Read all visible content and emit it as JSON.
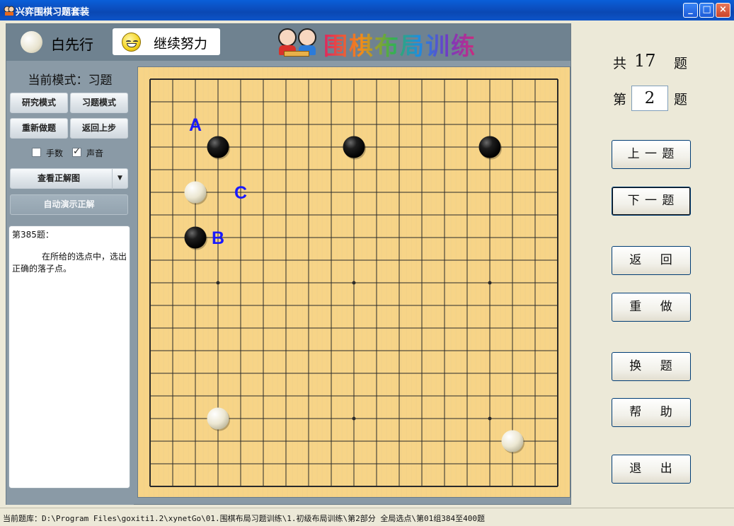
{
  "window": {
    "title": "兴弈围棋习题套装",
    "min": "_",
    "max": "□",
    "close": "×"
  },
  "header": {
    "turn_text": "白先行",
    "status_text": "继续努力",
    "banner_text": "围棋布局训练"
  },
  "sidebar": {
    "mode_title": "当前模式：习题",
    "buttons": {
      "research": "研究模式",
      "exercise": "习题模式",
      "redo": "重新做题",
      "back_step": "返回上步",
      "view_answer": "查看正解图",
      "auto_demo": "自动演示正解"
    },
    "checkboxes": {
      "move_numbers": {
        "label": "手数",
        "checked": false
      },
      "sound": {
        "label": "声音",
        "checked": true
      }
    },
    "problem": {
      "title": "第385题：",
      "description": "在所给的选点中，选出正确的落子点。"
    }
  },
  "board": {
    "size": 19,
    "stones": [
      {
        "color": "black",
        "col": 3,
        "row": 3
      },
      {
        "color": "black",
        "col": 9,
        "row": 3
      },
      {
        "color": "black",
        "col": 15,
        "row": 3
      },
      {
        "color": "white",
        "col": 2,
        "row": 5
      },
      {
        "color": "black",
        "col": 2,
        "row": 7
      },
      {
        "color": "white",
        "col": 3,
        "row": 15
      },
      {
        "color": "white",
        "col": 16,
        "row": 16
      }
    ],
    "marks": [
      {
        "label": "A",
        "col": 2,
        "row": 2
      },
      {
        "label": "C",
        "col": 4,
        "row": 5
      },
      {
        "label": "B",
        "col": 3,
        "row": 7
      }
    ],
    "colors": {
      "wood": "#f7d487",
      "line": "#2a2a2a",
      "mark": "#1a1aff"
    }
  },
  "right": {
    "total_prefix": "共",
    "total": "17",
    "total_suffix": "题",
    "current_prefix": "第",
    "current": "2",
    "current_suffix": "题",
    "buttons": {
      "prev": "上 一 题",
      "next": "下 一 题",
      "back": "返    回",
      "redo": "重    做",
      "change": "换    题",
      "help": "帮    助",
      "exit": "退    出"
    }
  },
  "statusbar": {
    "text": "当前题库：D:\\Program Files\\goxiti1.2\\xynetGo\\01.围棋布局习题训练\\1.初级布局训练\\第2部分 全局选点\\第01组384至400题"
  }
}
